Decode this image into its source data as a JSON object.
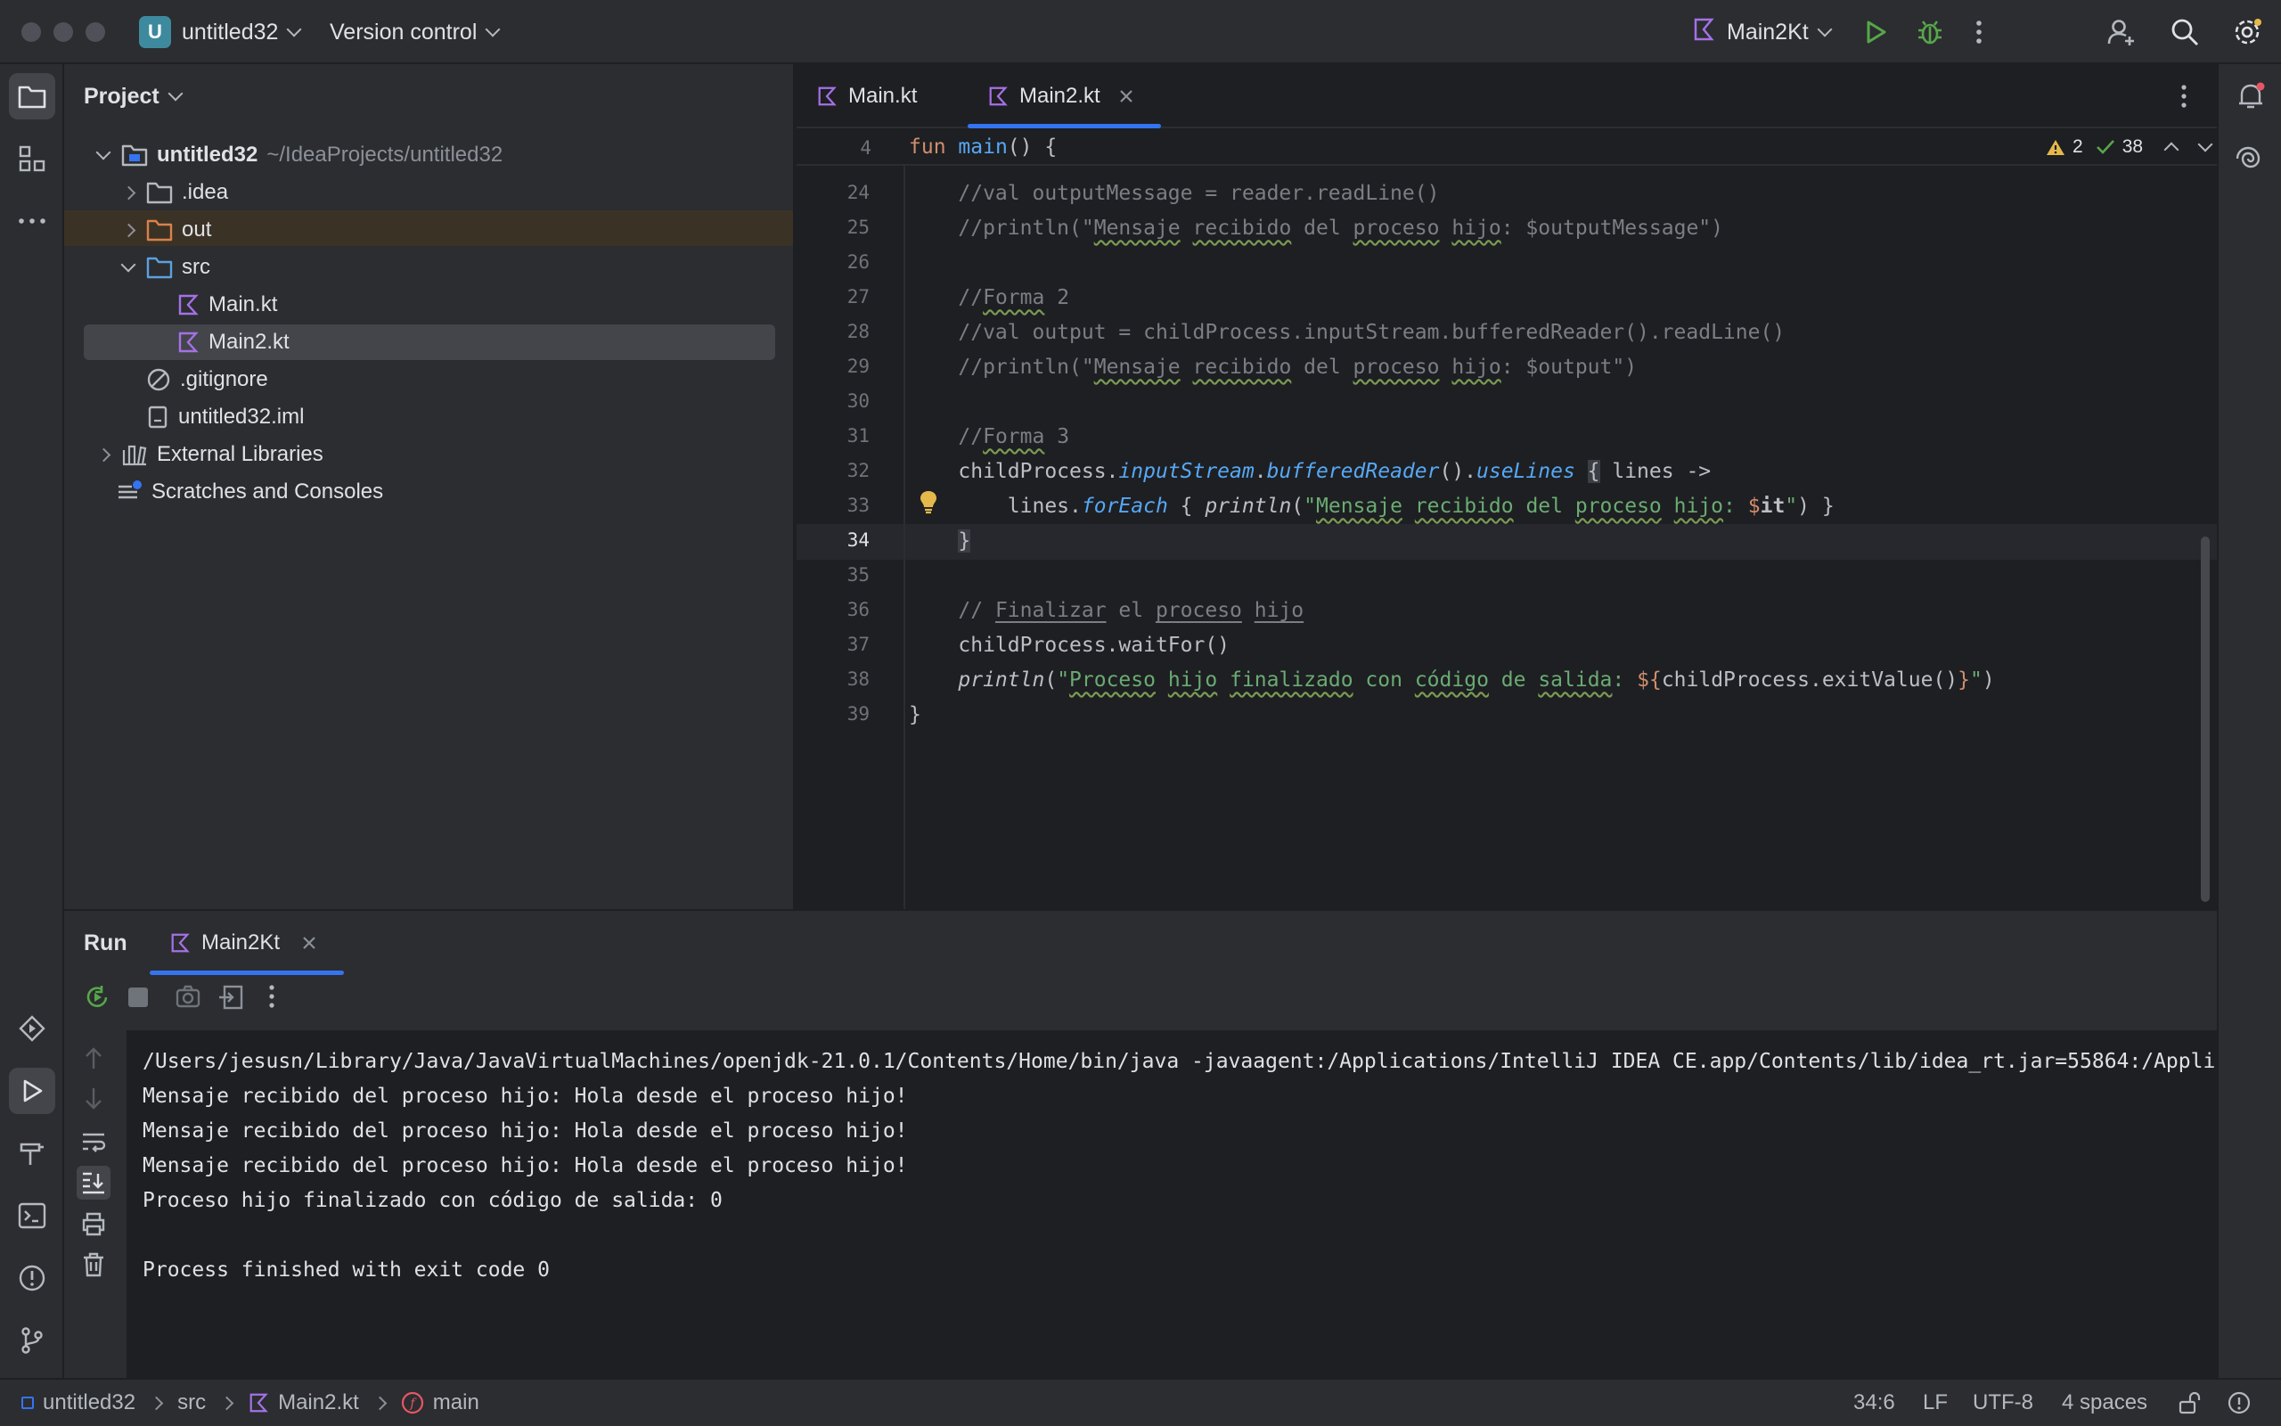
{
  "titlebar": {
    "project_badge": "U",
    "project_name": "untitled32",
    "version_control": "Version control",
    "run_config": "Main2Kt"
  },
  "project_panel": {
    "title": "Project",
    "root_name": "untitled32",
    "root_path": "~/IdeaProjects/untitled32",
    "items": [
      {
        "label": "untitled32"
      },
      {
        "label": ".idea"
      },
      {
        "label": "out"
      },
      {
        "label": "src"
      },
      {
        "label": "Main.kt"
      },
      {
        "label": "Main2.kt"
      },
      {
        "label": ".gitignore"
      },
      {
        "label": "untitled32.iml"
      },
      {
        "label": "External Libraries"
      },
      {
        "label": "Scratches and Consoles"
      }
    ]
  },
  "editor": {
    "tabs": [
      {
        "label": "Main.kt"
      },
      {
        "label": "Main2.kt"
      }
    ],
    "sticky_line_number": "4",
    "sticky_kw": "fun",
    "sticky_fn": "main",
    "sticky_rest": "() {",
    "warnings": "2",
    "checks": "38",
    "line_numbers": [
      "24",
      "25",
      "26",
      "27",
      "28",
      "29",
      "30",
      "31",
      "32",
      "33",
      "34",
      "35",
      "36",
      "37",
      "38",
      "39"
    ],
    "current_line": "34"
  },
  "run_panel": {
    "title": "Run",
    "tab_label": "Main2Kt",
    "console_lines": [
      "/Users/jesusn/Library/Java/JavaVirtualMachines/openjdk-21.0.1/Contents/Home/bin/java -javaagent:/Applications/IntelliJ IDEA CE.app/Contents/lib/idea_rt.jar=55864:/Appli",
      "Mensaje recibido del proceso hijo: Hola desde el proceso hijo!",
      "Mensaje recibido del proceso hijo: Hola desde el proceso hijo!",
      "Mensaje recibido del proceso hijo: Hola desde el proceso hijo!",
      "Proceso hijo finalizado con código de salida: 0",
      "",
      "Process finished with exit code 0"
    ]
  },
  "statusbar": {
    "breadcrumb": [
      "untitled32",
      "src",
      "Main2.kt",
      "main"
    ],
    "position": "34:6",
    "line_ending": "LF",
    "encoding": "UTF-8",
    "indent": "4 spaces"
  },
  "colors": {
    "accent": "#3574f0",
    "kotlin": "#a571e6",
    "run_green": "#57a64a",
    "warning": "#e5b84b"
  }
}
